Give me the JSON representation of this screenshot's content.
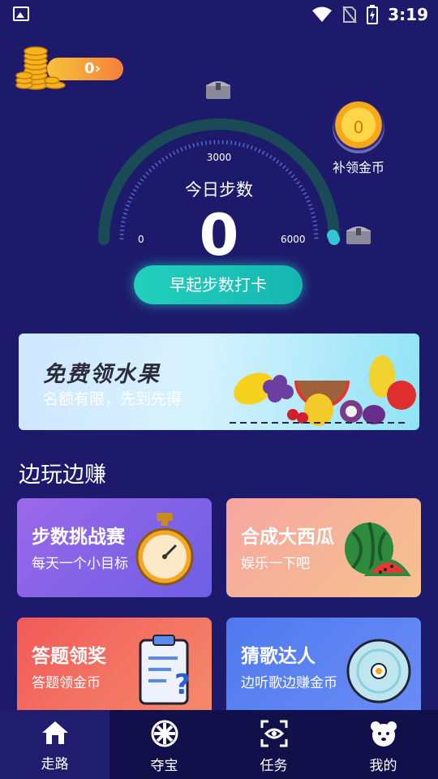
{
  "status_bar": {
    "time": "3:19"
  },
  "coins": {
    "count": "0"
  },
  "gauge": {
    "title": "今日步数",
    "steps": "0",
    "tick_min": "0",
    "tick_mid": "3000",
    "tick_max": "6000"
  },
  "supplement": {
    "coin_value": "0",
    "label": "补领金币"
  },
  "checkin_button": "早起步数打卡",
  "banner": {
    "title": "免费领水果",
    "subtitle": "名额有限，先到先得"
  },
  "section_title": "边玩边赚",
  "cards": [
    {
      "title": "步数挑战赛",
      "subtitle": "每天一个小目标"
    },
    {
      "title": "合成大西瓜",
      "subtitle": "娱乐一下吧"
    },
    {
      "title": "答题领奖",
      "subtitle": "答题领金币"
    },
    {
      "title": "猜歌达人",
      "subtitle": "边听歌边赚金币"
    }
  ],
  "nav": [
    {
      "label": "走路",
      "icon": "home-icon"
    },
    {
      "label": "夺宝",
      "icon": "wheel-icon"
    },
    {
      "label": "任务",
      "icon": "scan-eye-icon"
    },
    {
      "label": "我的",
      "icon": "bear-icon"
    }
  ],
  "colors": {
    "background": "#1e1a6b",
    "accent": "#1fc9b8",
    "nav_bg": "#12104a"
  }
}
